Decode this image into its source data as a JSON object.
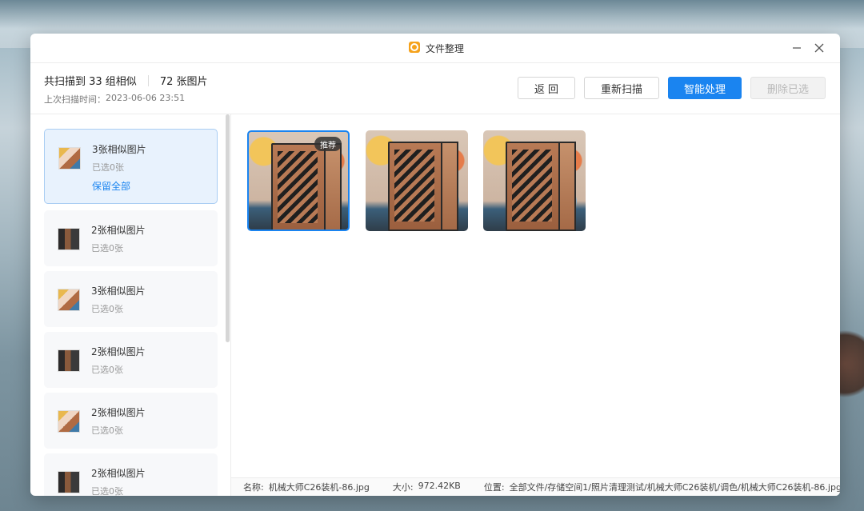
{
  "window": {
    "title": "文件整理",
    "app_icon": "file-organizer-icon",
    "accent_color": "#1a84f0"
  },
  "header": {
    "scan_summary": "共扫描到 33 组相似",
    "image_count": "72 张图片",
    "last_scan_label": "上次扫描时间：",
    "last_scan_time": "2023-06-06 23:51"
  },
  "toolbar": {
    "back_label": "返 回",
    "rescan_label": "重新扫描",
    "smart_label": "智能处理",
    "delete_label": "删除已选"
  },
  "sidebar": {
    "groups": [
      {
        "name": "3张相似图片",
        "selected_count": "已选0张",
        "keep_all": "保留全部"
      },
      {
        "name": "2张相似图片",
        "selected_count": "已选0张"
      },
      {
        "name": "3张相似图片",
        "selected_count": "已选0张"
      },
      {
        "name": "2张相似图片",
        "selected_count": "已选0张"
      },
      {
        "name": "2张相似图片",
        "selected_count": "已选0张"
      },
      {
        "name": "2张相似图片",
        "selected_count": "已选0张"
      }
    ]
  },
  "content": {
    "photos": [
      {
        "badge": "推荐",
        "selected": true
      },
      {
        "selected": false
      },
      {
        "selected": false
      }
    ]
  },
  "status": {
    "name_label": "名称:",
    "name_value": "机械大师C26装机-86.jpg",
    "size_label": "大小:",
    "size_value": "972.42KB",
    "path_label": "位置:",
    "path_value": "全部文件/存储空间1/照片清理测试/机械大师C26装机/调色/机械大师C26装机-86.jpg"
  }
}
